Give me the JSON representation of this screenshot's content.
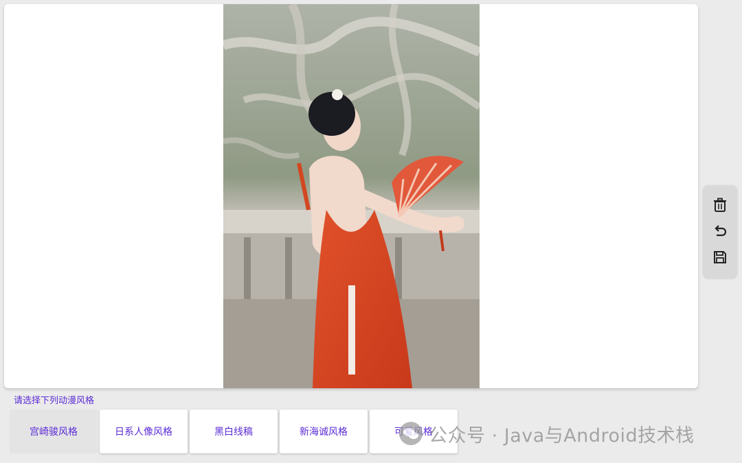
{
  "canvas": {
    "photo_icon": "stylized-photo"
  },
  "toolbar": {
    "delete_icon": "trash-icon",
    "undo_icon": "undo-icon",
    "save_icon": "save-icon"
  },
  "style_picker": {
    "prompt": "请选择下列动漫风格",
    "options": [
      {
        "label": "宫崎骏风格",
        "selected": true
      },
      {
        "label": "日系人像风格",
        "selected": false
      },
      {
        "label": "黑白线稿",
        "selected": false
      },
      {
        "label": "新海诚风格",
        "selected": false
      },
      {
        "label": "可爱风格",
        "selected": false
      }
    ]
  },
  "watermark": {
    "text": "公众号 · Java与Android技术栈"
  },
  "colors": {
    "accent": "#5b2bd6",
    "background": "#ebebeb"
  }
}
